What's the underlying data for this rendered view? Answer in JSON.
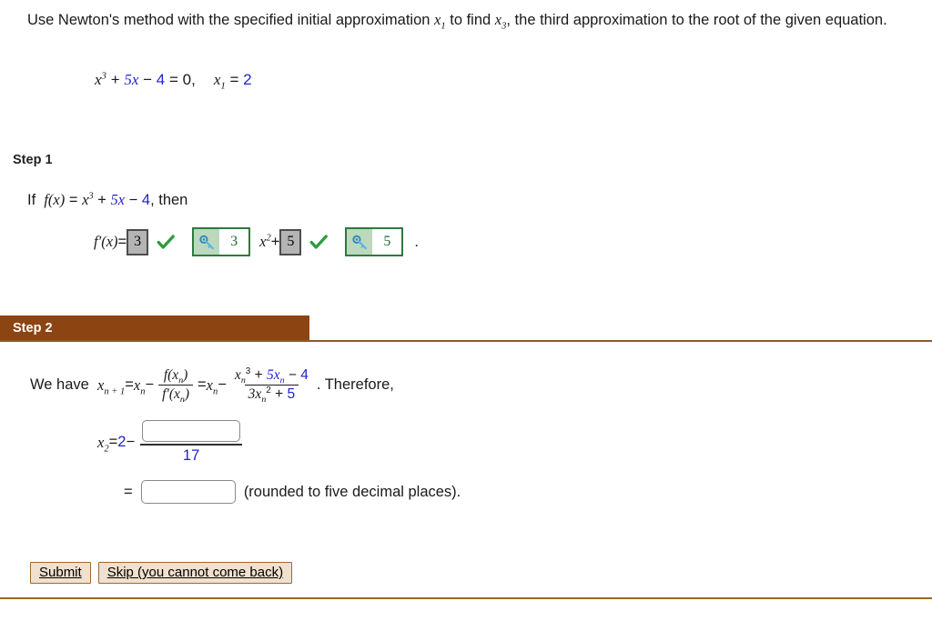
{
  "problem": {
    "instruction_part1": "Use Newton's method with the specified initial approximation ",
    "instruction_var1": "x",
    "instruction_sub1": "1",
    "instruction_part2": " to find ",
    "instruction_var2": "x",
    "instruction_sub2": "3",
    "instruction_part3": ", the third approximation to the root of the given equation.",
    "equation": {
      "var": "x",
      "exponent": "3",
      "plus": " + ",
      "term_5x": "5x",
      "minus": " − ",
      "const_4": "4",
      "equals_zero": " = 0,",
      "initial_var": "x",
      "initial_sub": "1",
      "initial_equals": " = ",
      "initial_value": "2"
    }
  },
  "step1": {
    "label": "Step 1",
    "if_text": "If",
    "fx": "f(x)",
    "equals": " = ",
    "x": "x",
    "exp3": "3",
    "plus": " + ",
    "term_5x": "5x",
    "minus": " − ",
    "const_4": "4",
    "comma_then": ",  then",
    "fprime": "f′(x)",
    "fprime_equals": " = ",
    "answer_coef": "3",
    "key_coef": "3",
    "x_term": "x",
    "x_exp": "2",
    "plus_mid": " + ",
    "answer_const": "5",
    "key_const": "5",
    "period": ".",
    "check_icon": "checkmark-icon",
    "key_icon": "key-icon"
  },
  "step2": {
    "label": "Step 2",
    "we_have": "We have",
    "x_left": "x",
    "x_left_sub": "n + 1",
    "eq1": " = ",
    "xn": "x",
    "xn_sub": "n",
    "minus1": " − ",
    "frac1_num": "f(x",
    "frac1_num_sub": "n",
    "frac1_num_end": ")",
    "frac1_den": "f′(x",
    "frac1_den_sub": "n",
    "frac1_den_end": ")",
    "eq2": " = ",
    "xn2": "x",
    "xn2_sub": "n",
    "minus2": " − ",
    "frac2_num_x": "x",
    "frac2_num_sub": "n",
    "frac2_num_exp": "3",
    "frac2_num_plus": " + ",
    "frac2_num_5x": "5x",
    "frac2_num_5x_sub": "n",
    "frac2_num_minus": " − ",
    "frac2_num_4": "4",
    "frac2_den_3x": "3x",
    "frac2_den_sub": "n",
    "frac2_den_exp": "2",
    "frac2_den_plus": " + ",
    "frac2_den_5": "5",
    "therefore": ".  Therefore,",
    "x2_var": "x",
    "x2_sub": "2",
    "x2_equals": " = ",
    "x2_value": "2",
    "x2_minus": " − ",
    "x2_numerator_value": "",
    "x2_denominator": "17",
    "result_equals": "=",
    "result_value": "",
    "result_note": "(rounded to five decimal places)."
  },
  "buttons": {
    "submit": "Submit",
    "skip": "Skip (you cannot come back)"
  },
  "colors": {
    "accent_blue": "#2222cc",
    "step_bar_brown": "#8c4413",
    "check_green": "#2e9b3f",
    "key_border_green": "#2c7a3f",
    "button_tan": "#f0e0cd"
  }
}
